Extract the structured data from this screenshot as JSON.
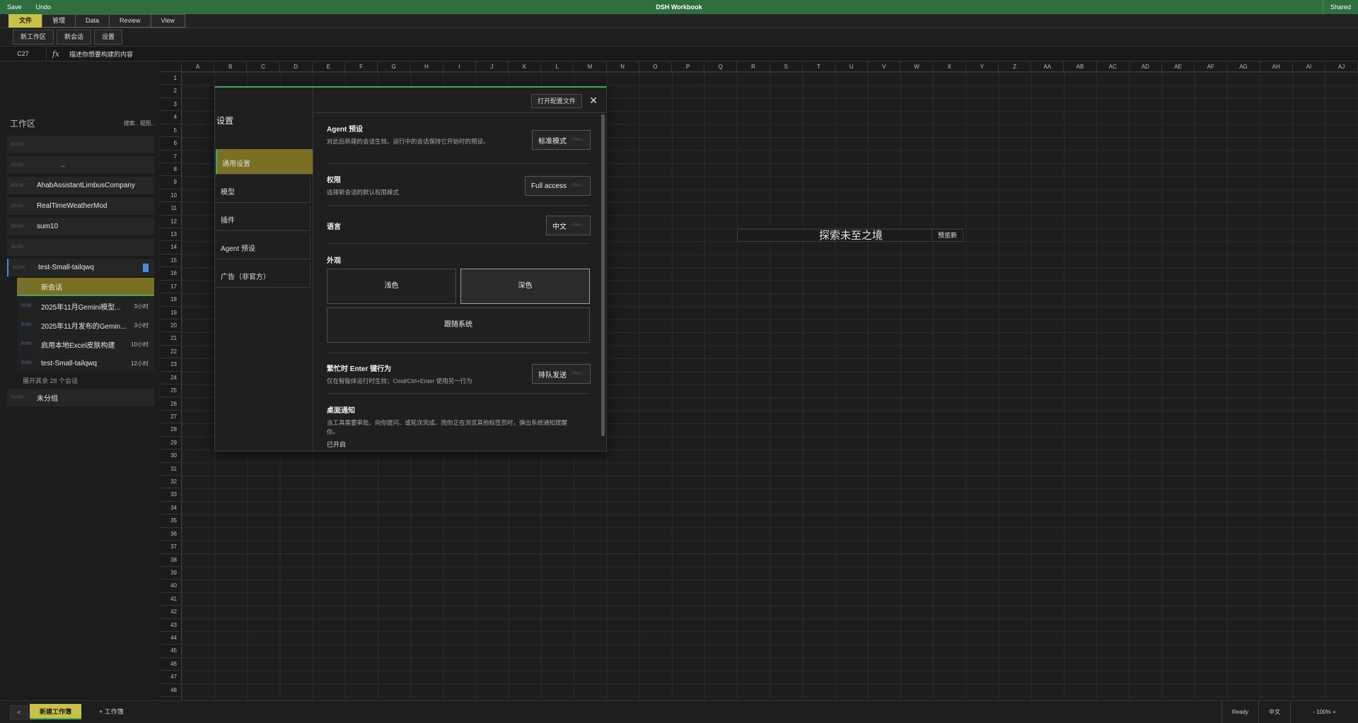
{
  "titlebar": {
    "save": "Save",
    "undo": "Undo",
    "title": "DSH Workbook",
    "shared": "Shared"
  },
  "ribbon": {
    "tabs": [
      "文件",
      "管理",
      "Data",
      "Review",
      "View"
    ]
  },
  "toolbar": {
    "buttons": [
      "新工作区",
      "新会话",
      "设置"
    ]
  },
  "formula_bar": {
    "cell_ref": "C27",
    "fx": "fx",
    "content": "描述你想要构建的内容"
  },
  "columns": [
    "A",
    "B",
    "C",
    "D",
    "E",
    "F",
    "G",
    "H",
    "I",
    "J",
    "K",
    "L",
    "M",
    "N",
    "O",
    "P",
    "Q",
    "R",
    "S",
    "T",
    "U",
    "V",
    "W",
    "X",
    "Y",
    "Z",
    "AA",
    "AB",
    "AC",
    "AD",
    "AE",
    "AF",
    "AG",
    "AH",
    "AI",
    "AJ"
  ],
  "sidebar": {
    "heading": "工作区",
    "actions": "搜索.. 视图..",
    "tag": "BOOK",
    "sub_tag": "ROW",
    "workspaces": [
      "",
      "..",
      "AhabAssistantLimbusCompany",
      "RealTimeWeatherMod",
      "sum10",
      "",
      "test-Small-tailqwq"
    ],
    "sessions": [
      {
        "label": "新会话",
        "time": ""
      },
      {
        "label": "2025年11月Gemini模型...",
        "time": "3小时"
      },
      {
        "label": "2025年11月发布的Gemin...",
        "time": "3小时"
      },
      {
        "label": "启用本地Excel皮肤构建",
        "time": "10小时"
      },
      {
        "label": "test-Small-tailqwq",
        "time": "12小时"
      }
    ],
    "more": "展开其余 28 个会话",
    "ungrouped": "未分组"
  },
  "overlay": {
    "title": "探索未至之境",
    "preview": "预览新"
  },
  "modal": {
    "title": "设置",
    "open_config": "打开配置文件",
    "close": "✕",
    "nav": [
      "通用设置",
      "模型",
      "插件",
      "Agent 预设",
      "广告（非官方）"
    ],
    "hint": "Filter ›",
    "sections": {
      "agent": {
        "title": "Agent 预设",
        "desc": "对此后新建的会话生效。运行中的会话保持它开始时的预设。",
        "value": "标准模式"
      },
      "permission": {
        "title": "权限",
        "desc": "选择新会话的默认权限模式",
        "value": "Full access"
      },
      "language": {
        "title": "语言",
        "value": "中文"
      },
      "appearance": {
        "title": "外观",
        "light": "浅色",
        "dark": "深色",
        "system": "跟随系统"
      },
      "enter": {
        "title": "繁忙时 Enter 键行为",
        "desc": "仅在智能体运行时生效；Cmd/Ctrl+Enter 使用另一行为",
        "value": "排队发送"
      },
      "notify": {
        "title": "桌面通知",
        "desc": "当工具需要审批、向你提问、或轮次完成，而你正在浏览其他标签页时，弹出系统通知提醒你。",
        "status": "已开启"
      }
    }
  },
  "statusbar": {
    "prev": "<",
    "sheet": "新建工作簿",
    "add": "+ 工作簿",
    "ready": "Ready",
    "lang": "中文",
    "zoom": "- 100% +"
  }
}
